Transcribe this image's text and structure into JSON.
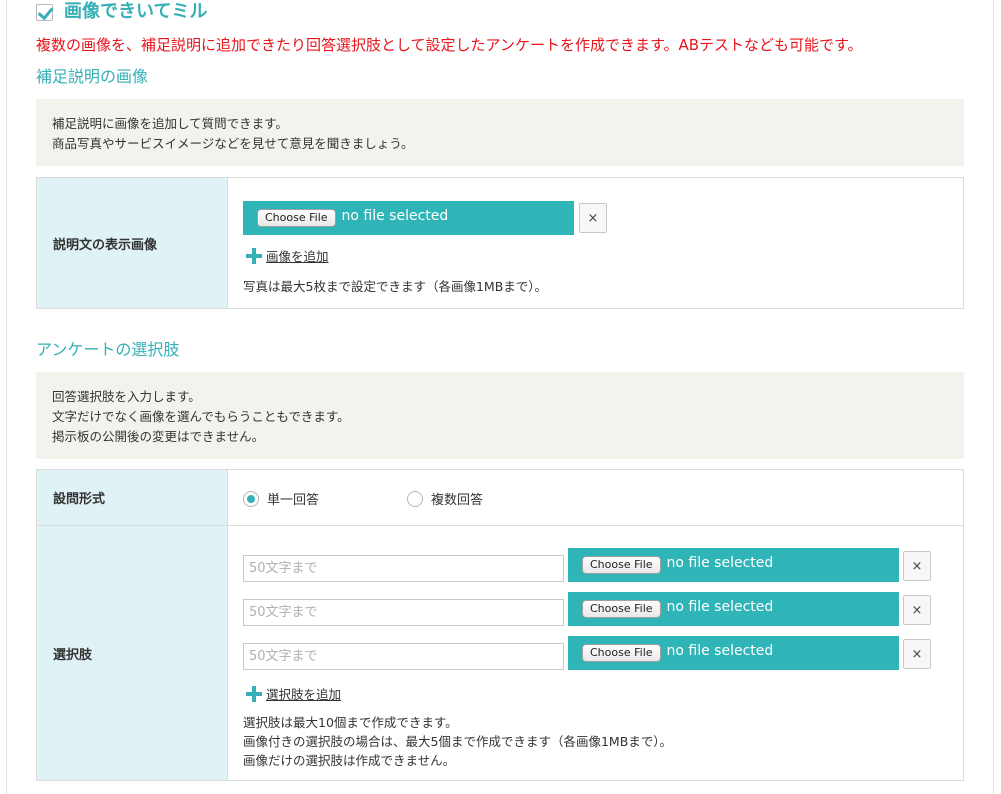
{
  "header": {
    "title": "画像できいてミル",
    "checked": true,
    "description": "複数の画像を、補足説明に追加できたり回答選択肢として設定したアンケートを作成できます。ABテストなども可能です。"
  },
  "supplement": {
    "title": "補足説明の画像",
    "info_lines": [
      "補足説明に画像を追加して質問できます。",
      "商品写真やサービスイメージなどを見せて意見を聞きましょう。"
    ],
    "field_label": "説明文の表示画像",
    "file": {
      "button_label": "Choose File",
      "status": "no file selected"
    },
    "close_label": "×",
    "add_label": "画像を追加",
    "note": "写真は最大5枚まで設定できます（各画像1MBまで）。"
  },
  "choices": {
    "title": "アンケートの選択肢",
    "info_lines": [
      "回答選択肢を入力します。",
      "文字だけでなく画像を選んでもらうこともできます。",
      "掲示板の公開後の変更はできません。"
    ],
    "question_type": {
      "label": "設問形式",
      "options": [
        {
          "label": "単一回答",
          "selected": true
        },
        {
          "label": "複数回答",
          "selected": false
        }
      ]
    },
    "field_label": "選択肢",
    "items": [
      {
        "placeholder": "50文字まで",
        "button_label": "Choose File",
        "status": "no file selected",
        "close_label": "×"
      },
      {
        "placeholder": "50文字まで",
        "button_label": "Choose File",
        "status": "no file selected",
        "close_label": "×"
      },
      {
        "placeholder": "50文字まで",
        "button_label": "Choose File",
        "status": "no file selected",
        "close_label": "×"
      }
    ],
    "add_label": "選択肢を追加",
    "notes": [
      "選択肢は最大10個まで作成できます。",
      "画像付きの選択肢の場合は、最大5個まで作成できます（各画像1MBまで）。",
      "画像だけの選択肢は作成できません。"
    ]
  },
  "colors": {
    "accent": "#34b0b6",
    "file_box": "#2fb4b8",
    "warning": "#e8141c",
    "label_bg": "#dff2f5",
    "info_bg": "#f3f2ec"
  },
  "icons": {
    "header_check": "checkbox-checked-icon",
    "add": "plus-icon",
    "remove": "close-icon",
    "radio": "radio-icon"
  }
}
